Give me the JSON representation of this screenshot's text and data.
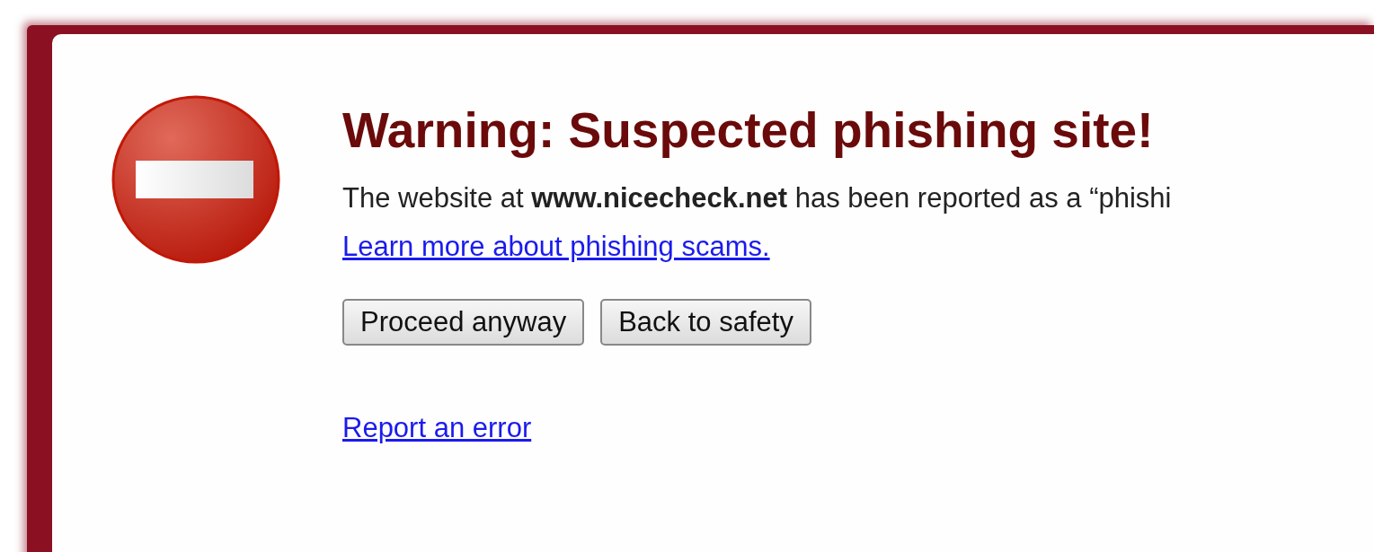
{
  "heading": "Warning: Suspected phishing site!",
  "description": "The website at **www.nicecheck.net** has been reported as a “phishi",
  "learn_more_link": "Learn more about phishing scams.",
  "buttons": [
    {
      "label": "Proceed anyway"
    },
    {
      "label": "Back to safety"
    }
  ],
  "report_link": "Report an error"
}
